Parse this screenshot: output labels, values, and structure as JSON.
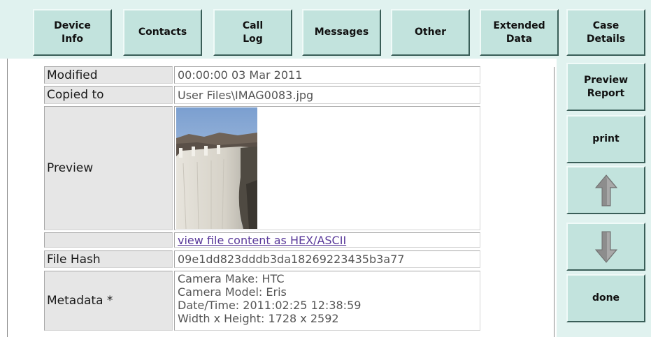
{
  "tabs": [
    {
      "id": "device-info",
      "label": "Device\nInfo"
    },
    {
      "id": "contacts",
      "label": "Contacts"
    },
    {
      "id": "call-log",
      "label": "Call\nLog"
    },
    {
      "id": "messages",
      "label": "Messages"
    },
    {
      "id": "other",
      "label": "Other"
    },
    {
      "id": "extended-data",
      "label": "Extended\nData"
    },
    {
      "id": "case-details",
      "label": "Case\nDetails"
    }
  ],
  "sidebar": {
    "preview_report": "Preview\nReport",
    "print": "print",
    "up_icon": "arrow-up-icon",
    "down_icon": "arrow-down-icon",
    "done": "done"
  },
  "details": {
    "modified": {
      "label": "Modified",
      "value": "00:00:00 03 Mar 2011"
    },
    "copied_to": {
      "label": "Copied to",
      "value": "User Files\\IMAG0083.jpg"
    },
    "preview": {
      "label": "Preview",
      "image": "hoover-dam-photo"
    },
    "hex_link": "view file content as HEX/ASCII",
    "file_hash": {
      "label": "File Hash",
      "value": "09e1dd823dddb3da18269223435b3a77"
    },
    "metadata": {
      "label": "Metadata *",
      "lines": [
        "Camera Make: HTC",
        "Camera Model: Eris",
        "Date/Time: 2011:02:25 12:38:59",
        "Width x Height: 1728 x 2592"
      ]
    }
  },
  "colors": {
    "panel_bg": "#e0f2ef",
    "button_bg": "#c2e3dd",
    "label_bg": "#e6e6e6",
    "link": "#5a3a9a",
    "arrow": "#8d8d8d"
  }
}
